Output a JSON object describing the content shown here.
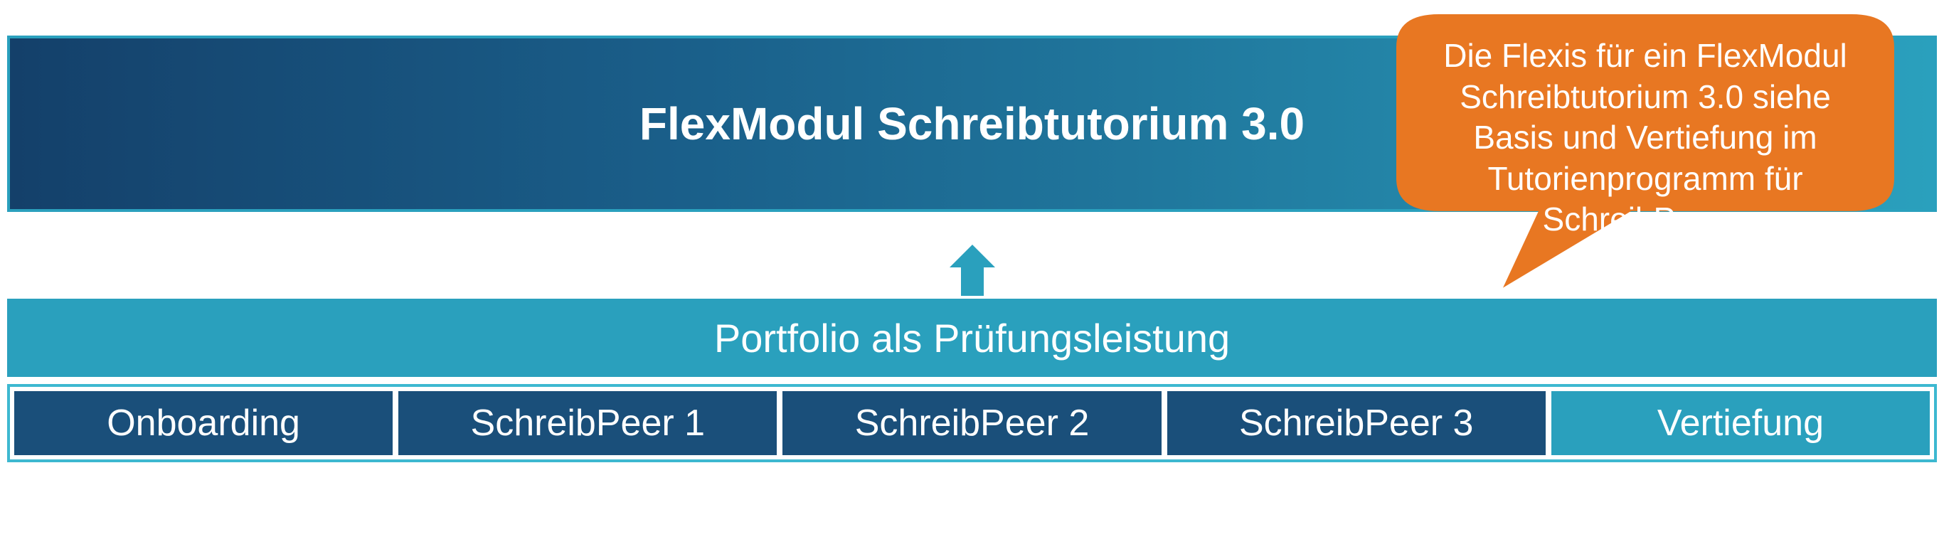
{
  "banner": {
    "title": "FlexModul Schreibtutorium 3.0"
  },
  "portfolio": {
    "label": "Portfolio als Prüfungsleistung"
  },
  "stages": [
    {
      "label": "Onboarding",
      "highlight": false
    },
    {
      "label": "SchreibPeer 1",
      "highlight": false
    },
    {
      "label": "SchreibPeer 2",
      "highlight": false
    },
    {
      "label": "SchreibPeer 3",
      "highlight": false
    },
    {
      "label": "Vertiefung",
      "highlight": true
    }
  ],
  "callout": {
    "text": "Die Flexis für ein FlexModul Schreibtutorium 3.0  siehe Basis und Vertiefung im Tutorienprogramm für SchreibPeers.",
    "color": "#e87722"
  },
  "arrow": {
    "color": "#2aa0bd"
  }
}
